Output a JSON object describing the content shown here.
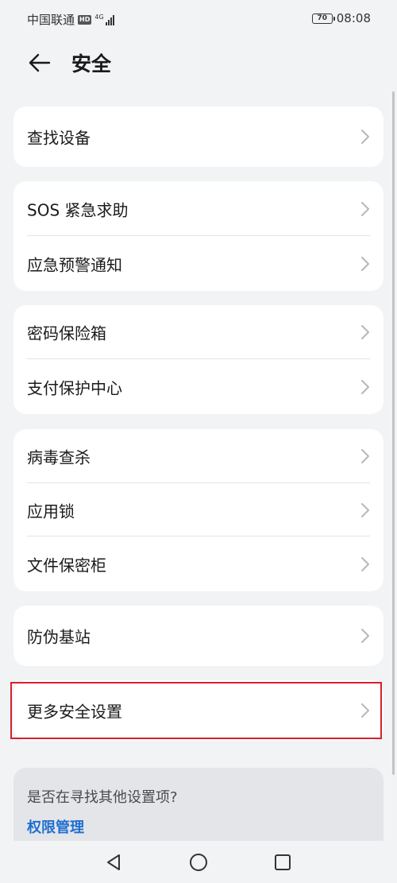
{
  "status_bar": {
    "carrier": "中国联通",
    "hd_badge": "HD",
    "network": "4G",
    "battery": "70",
    "time": "08:08"
  },
  "header": {
    "title": "安全",
    "back_icon": "arrow-left-icon"
  },
  "groups": [
    {
      "items": [
        {
          "label": "查找设备"
        }
      ]
    },
    {
      "items": [
        {
          "label": "SOS 紧急求助"
        },
        {
          "label": "应急预警通知"
        }
      ]
    },
    {
      "items": [
        {
          "label": "密码保险箱"
        },
        {
          "label": "支付保护中心"
        }
      ]
    },
    {
      "items": [
        {
          "label": "病毒查杀"
        },
        {
          "label": "应用锁"
        },
        {
          "label": "文件保密柜"
        }
      ]
    },
    {
      "items": [
        {
          "label": "防伪基站"
        }
      ]
    },
    {
      "items": [
        {
          "label": "更多安全设置"
        }
      ]
    }
  ],
  "suggestion": {
    "title": "是否在寻找其他设置项?",
    "link": "权限管理"
  },
  "nav_bar": {
    "back": "triangle-back-icon",
    "home": "circle-home-icon",
    "recents": "square-recents-icon"
  },
  "colors": {
    "background": "#f1f3f5",
    "card": "#ffffff",
    "highlight": "#d8202b",
    "link": "#1f6fd1"
  }
}
